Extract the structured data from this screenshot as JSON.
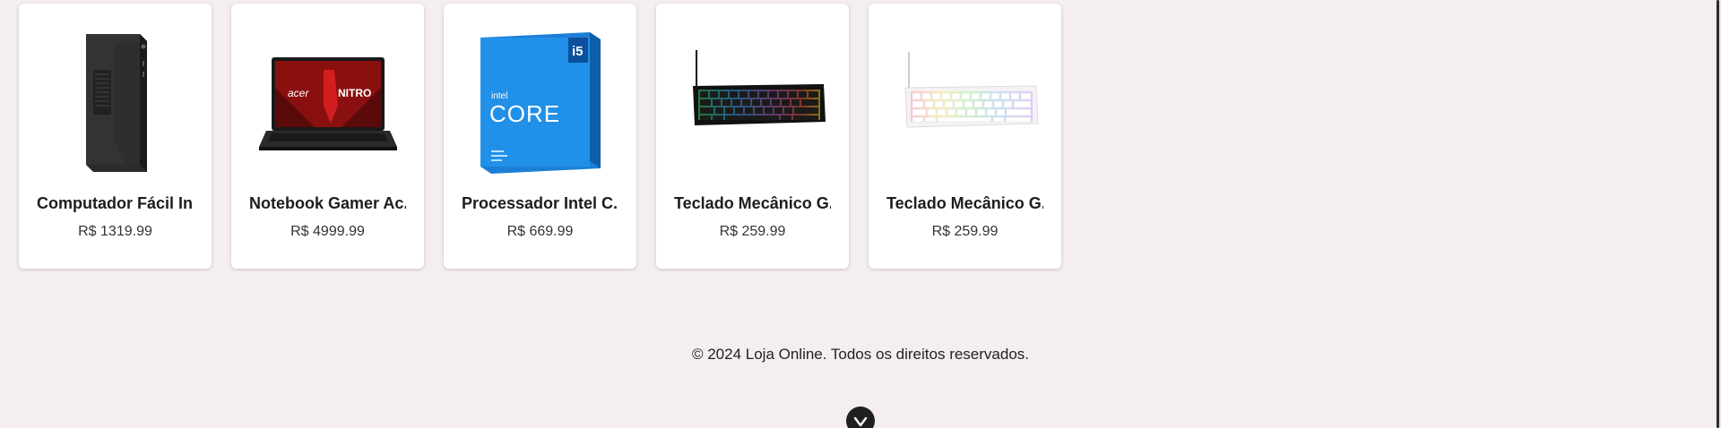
{
  "products": [
    {
      "name": "Computador Fácil In...",
      "price": "R$ 1319.99",
      "image_icon": "desktop-tower-icon"
    },
    {
      "name": "Notebook Gamer Ac...",
      "price": "R$ 4999.99",
      "image_icon": "laptop-icon"
    },
    {
      "name": "Processador Intel C...",
      "price": "R$ 669.99",
      "image_icon": "cpu-box-icon",
      "image_text": {
        "brand": "intel",
        "model": "CORE",
        "tier": "i5"
      }
    },
    {
      "name": "Teclado Mecânico G...",
      "price": "R$ 259.99",
      "image_icon": "keyboard-black-rgb-icon"
    },
    {
      "name": "Teclado Mecânico G...",
      "price": "R$ 259.99",
      "image_icon": "keyboard-white-rgb-icon"
    }
  ],
  "footer": {
    "copyright": "© 2024 Loja Online. Todos os direitos reservados."
  },
  "colors": {
    "background": "#f5eeee",
    "card": "#ffffff",
    "scroll_button": "#1f1f1f"
  }
}
